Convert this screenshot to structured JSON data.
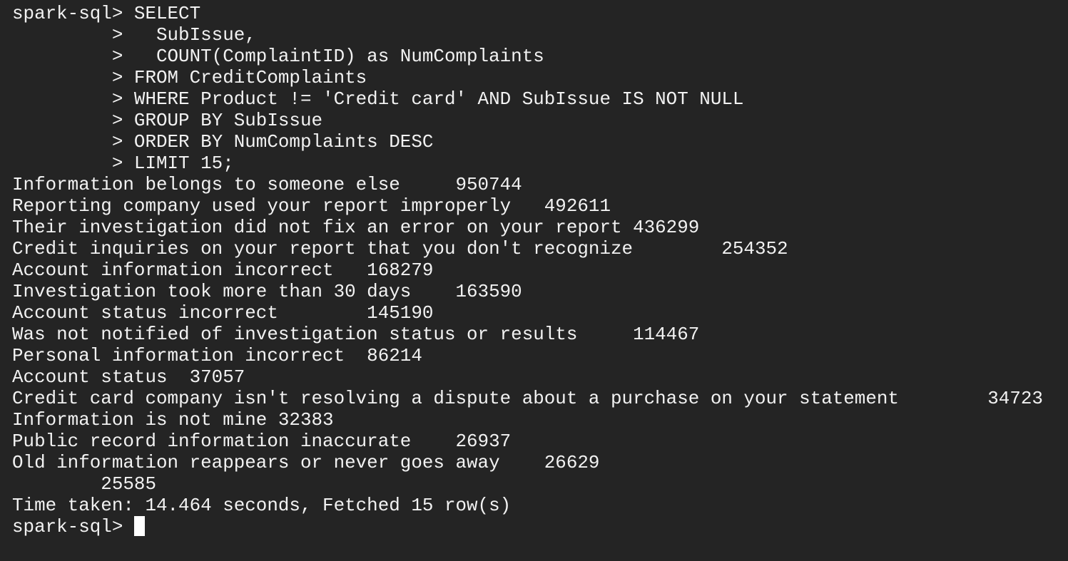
{
  "terminal": {
    "lines": [
      "spark-sql> SELECT",
      "         >   SubIssue,",
      "         >   COUNT(ComplaintID) as NumComplaints",
      "         > FROM CreditComplaints",
      "         > WHERE Product != 'Credit card' AND SubIssue IS NOT NULL",
      "         > GROUP BY SubIssue",
      "         > ORDER BY NumComplaints DESC",
      "         > LIMIT 15;",
      "Information belongs to someone else     950744",
      "Reporting company used your report improperly   492611",
      "Their investigation did not fix an error on your report 436299",
      "Credit inquiries on your report that you don't recognize        254352",
      "Account information incorrect   168279",
      "Investigation took more than 30 days    163590",
      "Account status incorrect        145190",
      "Was not notified of investigation status or results     114467",
      "Personal information incorrect  86214",
      "Account status  37057",
      "Credit card company isn't resolving a dispute about a purchase on your statement        34723",
      "Information is not mine 32383",
      "Public record information inaccurate    26937",
      "Old information reappears or never goes away    26629",
      "        25585",
      "Time taken: 14.464 seconds, Fetched 15 row(s)"
    ],
    "prompt": "spark-sql> "
  }
}
